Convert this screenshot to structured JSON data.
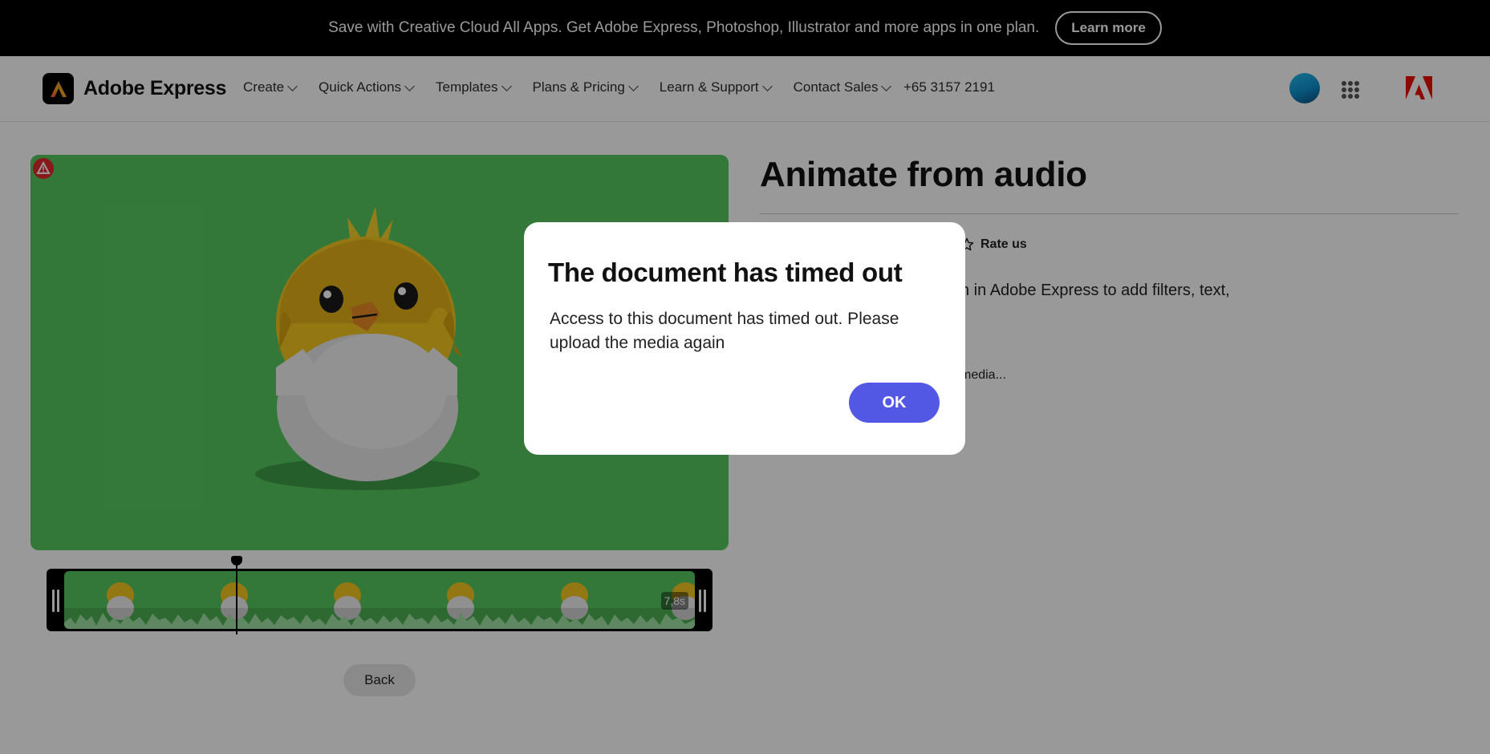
{
  "promo": {
    "text": "Save with Creative Cloud All Apps. Get Adobe Express, Photoshop, Illustrator and more apps in one plan.",
    "button": "Learn more"
  },
  "header": {
    "brand": "Adobe Express",
    "nav": [
      "Create",
      "Quick Actions",
      "Templates",
      "Plans & Pricing",
      "Learn & Support",
      "Contact Sales"
    ],
    "phone": "+65 3157 2191"
  },
  "main": {
    "title": "Animate from audio",
    "rate": "Rate us",
    "description_fragment": "n in Adobe Express to add filters, text,",
    "media_fragment": "media...",
    "duration": "7,8s",
    "back": "Back"
  },
  "dialog": {
    "title": "The document has timed out",
    "body": "Access to this document has timed out. Please upload the media again",
    "ok": "OK"
  },
  "colors": {
    "accent": "#5258e4",
    "canvas": "#57c95f",
    "promo_bg": "#000000",
    "adobe_red": "#eb1000"
  },
  "icons": [
    "adobe-express-logo-icon",
    "chevron-down-icon",
    "avatar",
    "app-switcher-icon",
    "adobe-logo-icon",
    "warning-icon",
    "star-icon"
  ]
}
